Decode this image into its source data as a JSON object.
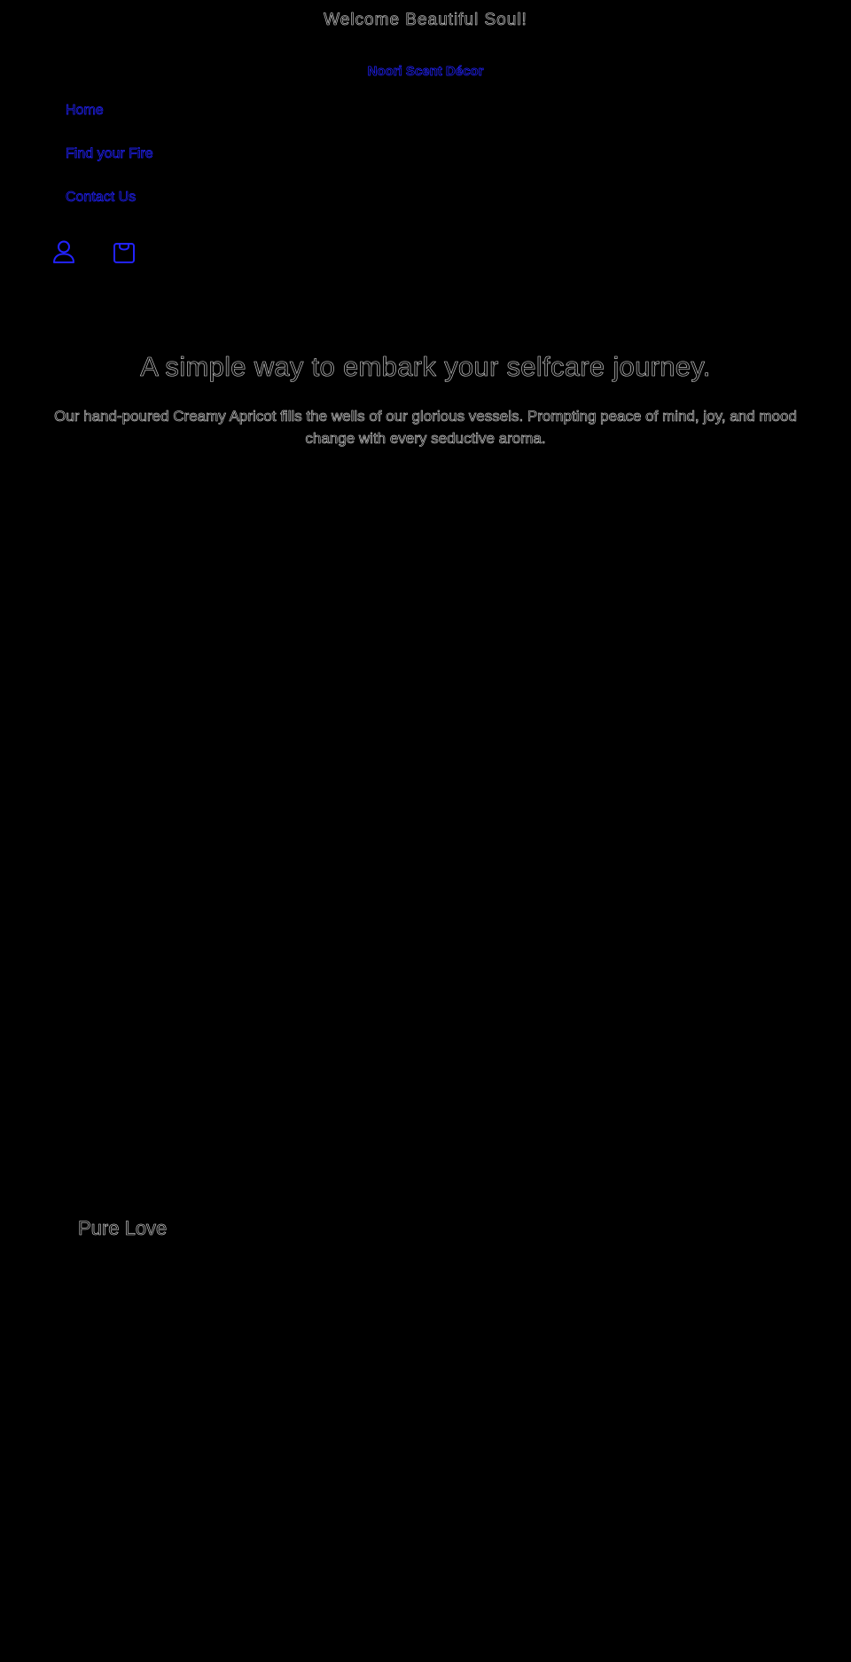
{
  "announcement": {
    "text": "Welcome Beautiful Soul!"
  },
  "header": {
    "brand": "Noori Scent Décor",
    "nav": {
      "items": [
        {
          "label": "Home"
        },
        {
          "label": "Find your Fire"
        },
        {
          "label": "Contact Us"
        }
      ]
    },
    "icons": {
      "account": "account-icon",
      "cart": "cart-icon"
    }
  },
  "hero": {
    "title": "A simple way to embark your selfcare journey.",
    "text": "Our hand-poured Creamy Apricot fills the wells of our glorious vessels. Prompting peace of mind, joy, and mood change with every seductive aroma."
  },
  "section": {
    "heading": "Pure Love"
  },
  "colors": {
    "background": "#000000",
    "link": "#2222ff",
    "text_edge": "#cfcfcf"
  }
}
